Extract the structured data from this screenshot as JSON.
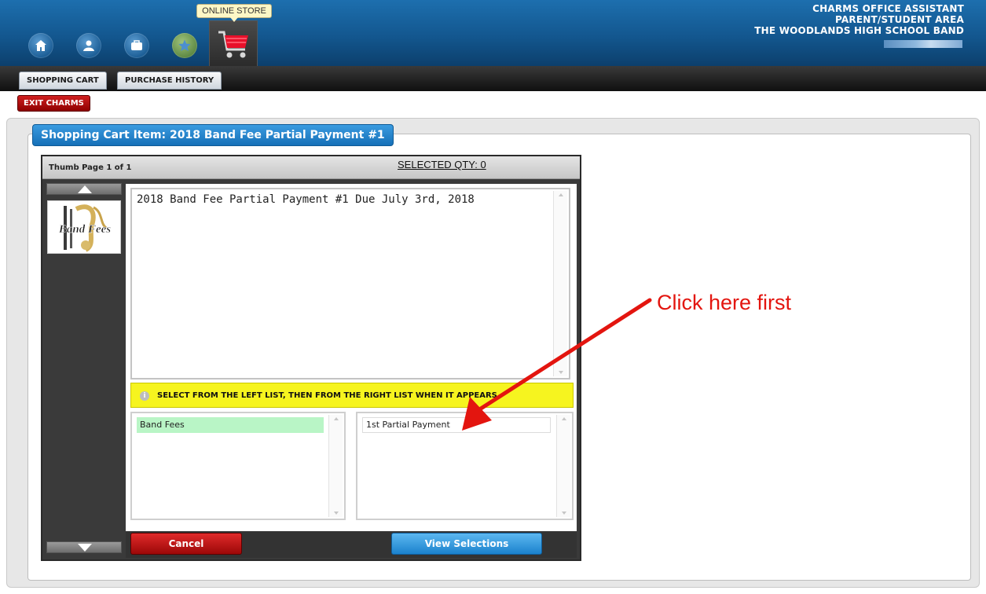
{
  "header": {
    "nav": [
      {
        "name": "home-icon"
      },
      {
        "name": "profile-icon"
      },
      {
        "name": "briefcase-icon"
      },
      {
        "name": "star-icon"
      },
      {
        "name": "shopping-cart-icon"
      }
    ],
    "store_tooltip": "ONLINE STORE",
    "brand_lines": [
      "CHARMS OFFICE ASSISTANT",
      "PARENT/STUDENT AREA",
      "THE WOODLANDS HIGH SCHOOL BAND"
    ]
  },
  "toolbar": {
    "tabs": [
      "SHOPPING CART",
      "PURCHASE HISTORY"
    ],
    "exit_label": "EXIT CHARMS"
  },
  "main": {
    "title": "Shopping Cart Item: 2018 Band Fee Partial Payment #1",
    "thumb_page": "Thumb Page 1 of 1",
    "selected_qty": "SELECTED QTY: 0",
    "thumbnail_alt": "Band Fees",
    "description": "2018 Band Fee Partial Payment #1 Due July 3rd, 2018",
    "notice": "SELECT FROM THE LEFT LIST, THEN FROM THE RIGHT LIST WHEN IT APPEARS.",
    "left_list": [
      "Band Fees"
    ],
    "right_list": [
      "1st Partial Payment"
    ],
    "cancel_label": "Cancel",
    "view_label": "View Selections"
  },
  "annotation": {
    "text": "Click here first",
    "color": "#e3150f"
  },
  "colors": {
    "header_blue": "#13578f",
    "notice_yellow": "#f6f41f",
    "selected_green": "#b9f5c6",
    "cancel_red": "#c41515",
    "view_blue": "#2b93db"
  }
}
